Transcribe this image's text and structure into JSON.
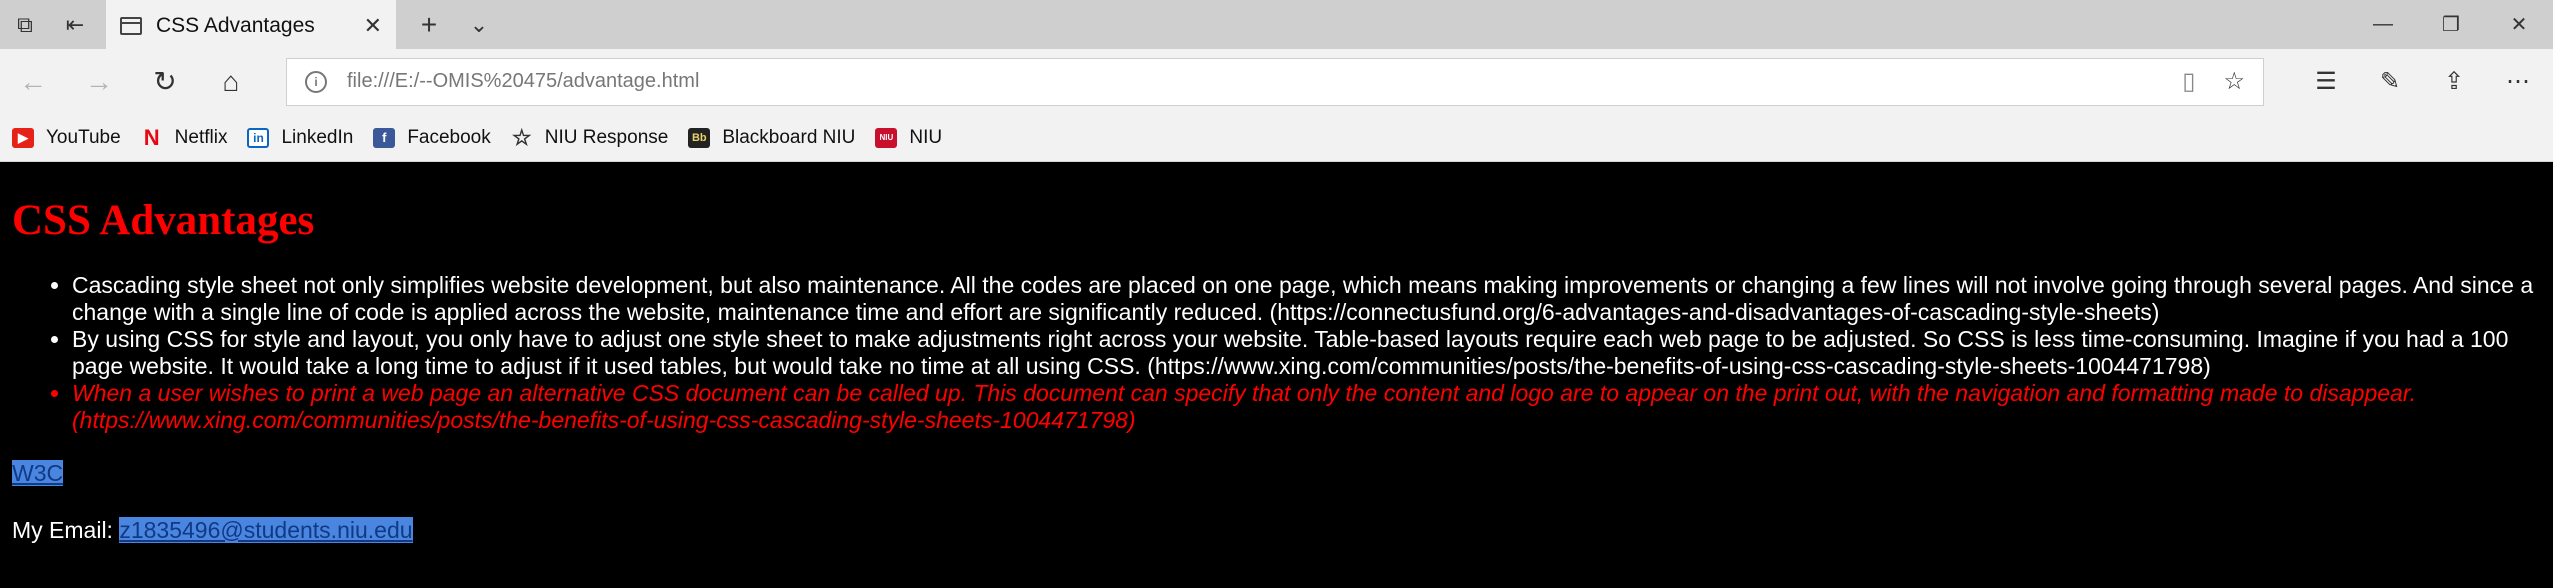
{
  "browser": {
    "tab_title": "CSS Advantages",
    "address": "file:///E:/--OMIS%20475/advantage.html",
    "favorites": [
      {
        "label": "YouTube",
        "icon": "youtube-icon"
      },
      {
        "label": "Netflix",
        "icon": "netflix-icon"
      },
      {
        "label": "LinkedIn",
        "icon": "linkedin-icon"
      },
      {
        "label": "Facebook",
        "icon": "facebook-icon"
      },
      {
        "label": "NIU Response",
        "icon": "star-icon"
      },
      {
        "label": "Blackboard NIU",
        "icon": "blackboard-icon"
      },
      {
        "label": "NIU",
        "icon": "niu-icon"
      }
    ]
  },
  "page": {
    "heading": "CSS Advantages",
    "bullets": [
      "Cascading style sheet not only simplifies website development, but also maintenance. All the codes are placed on one page, which means making improvements or changing a few lines will not involve going through several pages. And since a change with a single line of code is applied across the website, maintenance time and effort are significantly reduced. (https://connectusfund.org/6-advantages-and-disadvantages-of-cascading-style-sheets)",
      "By using CSS for style and layout, you only have to adjust one style sheet to make adjustments right across your website. Table-based layouts require each web page to be adjusted. So CSS is less time-consuming. Imagine if you had a 100 page website. It would take a long time to adjust if it used tables, but would take no time at all using CSS. (https://www.xing.com/communities/posts/the-benefits-of-using-css-cascading-style-sheets-1004471798)",
      "When a user wishes to print a web page an alternative CSS document can be called up. This document can specify that only the content and logo are to appear on the print out, with the navigation and formatting made to disappear. (https://www.xing.com/communities/posts/the-benefits-of-using-css-cascading-style-sheets-1004471798)"
    ],
    "w3c_link": "W3C",
    "email_label": "My Email:",
    "email_link": "z1835496@students.niu.edu"
  },
  "colors": {
    "heading": "#ff0000",
    "background": "#000000",
    "text": "#ffffff",
    "italic_bullet": "#ff0000"
  }
}
